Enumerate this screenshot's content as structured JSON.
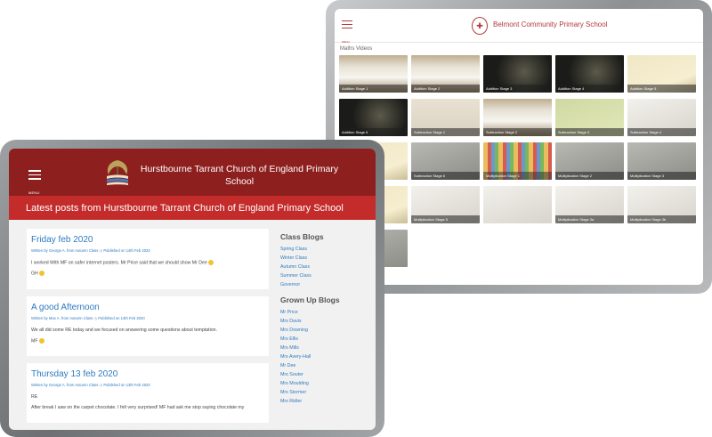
{
  "back": {
    "menu_label": "MENU",
    "school_title": "Belmont Community Primary School",
    "section_title": "Maths Videos",
    "videos": [
      {
        "caption": "Addition Stage 1",
        "style": "t-board"
      },
      {
        "caption": "Addition Stage 2",
        "style": "t-board"
      },
      {
        "caption": "Addition Stage 3",
        "style": "t-dark"
      },
      {
        "caption": "Addition Stage 4",
        "style": "t-dark"
      },
      {
        "caption": "Addition Stage 5",
        "style": "t-paper"
      },
      {
        "caption": "Addition Stage 6",
        "style": "t-dark"
      },
      {
        "caption": "Subtraction Stage 1",
        "style": "t-blocks"
      },
      {
        "caption": "Subtraction Stage 2",
        "style": "t-board"
      },
      {
        "caption": "Subtraction Stage 3",
        "style": "t-green"
      },
      {
        "caption": "Subtraction Stage 4",
        "style": "t-white"
      },
      {
        "caption": "",
        "style": "t-paper"
      },
      {
        "caption": "Subtraction Stage 6",
        "style": "t-grey"
      },
      {
        "caption": "Multiplication Stage 1",
        "style": "t-cubes"
      },
      {
        "caption": "Multiplication Stage 2",
        "style": "t-grey"
      },
      {
        "caption": "Multiplication Stage 3",
        "style": "t-grey"
      },
      {
        "caption": "",
        "style": "t-paper"
      },
      {
        "caption": "Multiplication Stage 5",
        "style": "t-white"
      },
      {
        "caption": "",
        "style": "t-white"
      },
      {
        "caption": "Multiplication Stage 3a",
        "style": "t-white"
      },
      {
        "caption": "Multiplication Stage 3b",
        "style": "t-white"
      },
      {
        "caption": "",
        "style": "t-grey"
      }
    ]
  },
  "front": {
    "menu_label": "MENU",
    "school_title": "Hurstbourne Tarrant Church of England Primary School",
    "banner": "Latest posts from Hurstbourne Tarrant Church of England Primary School",
    "posts": [
      {
        "title": "Friday feb 2020",
        "author": "Written by George A. from Autumn Class",
        "published": "Published on 14th Feb 2020",
        "body": "I worked With MF on safer internet posters. Mr Price said that we should show Mr Dee",
        "sign": "GH"
      },
      {
        "title": "A good Afternoon",
        "author": "Written by Max A. from Autumn Class",
        "published": "Published on 14th Feb 2020",
        "body": "We all did some RE today and we focused on answering some questions about temptation.",
        "sign": "MF"
      },
      {
        "title": "Thursday 13 feb 2020",
        "author": "Written by George A. from Autumn Class",
        "published": "Published on 13th Feb 2020",
        "body": "RE",
        "sign": "After break I saw on the carpet chocolate. I felt very surprised! MF had ask me stop saying chocolate my"
      }
    ],
    "sidebar": {
      "class_heading": "Class Blogs",
      "classes": [
        "Spring Class",
        "Winter Class",
        "Autumn Class",
        "Summer Class",
        "Governor"
      ],
      "grown_heading": "Grown Up Blogs",
      "grown": [
        "Mr Price",
        "Mrs Davis",
        "Mrs Downing",
        "Mrs Ellis",
        "Mrs Mills",
        "Mrs Avery-Hall",
        "Mr Dee",
        "Mrs Souter",
        "Mrs Moulding",
        "Mrs Stormer",
        "Mrs Ridler"
      ]
    }
  }
}
